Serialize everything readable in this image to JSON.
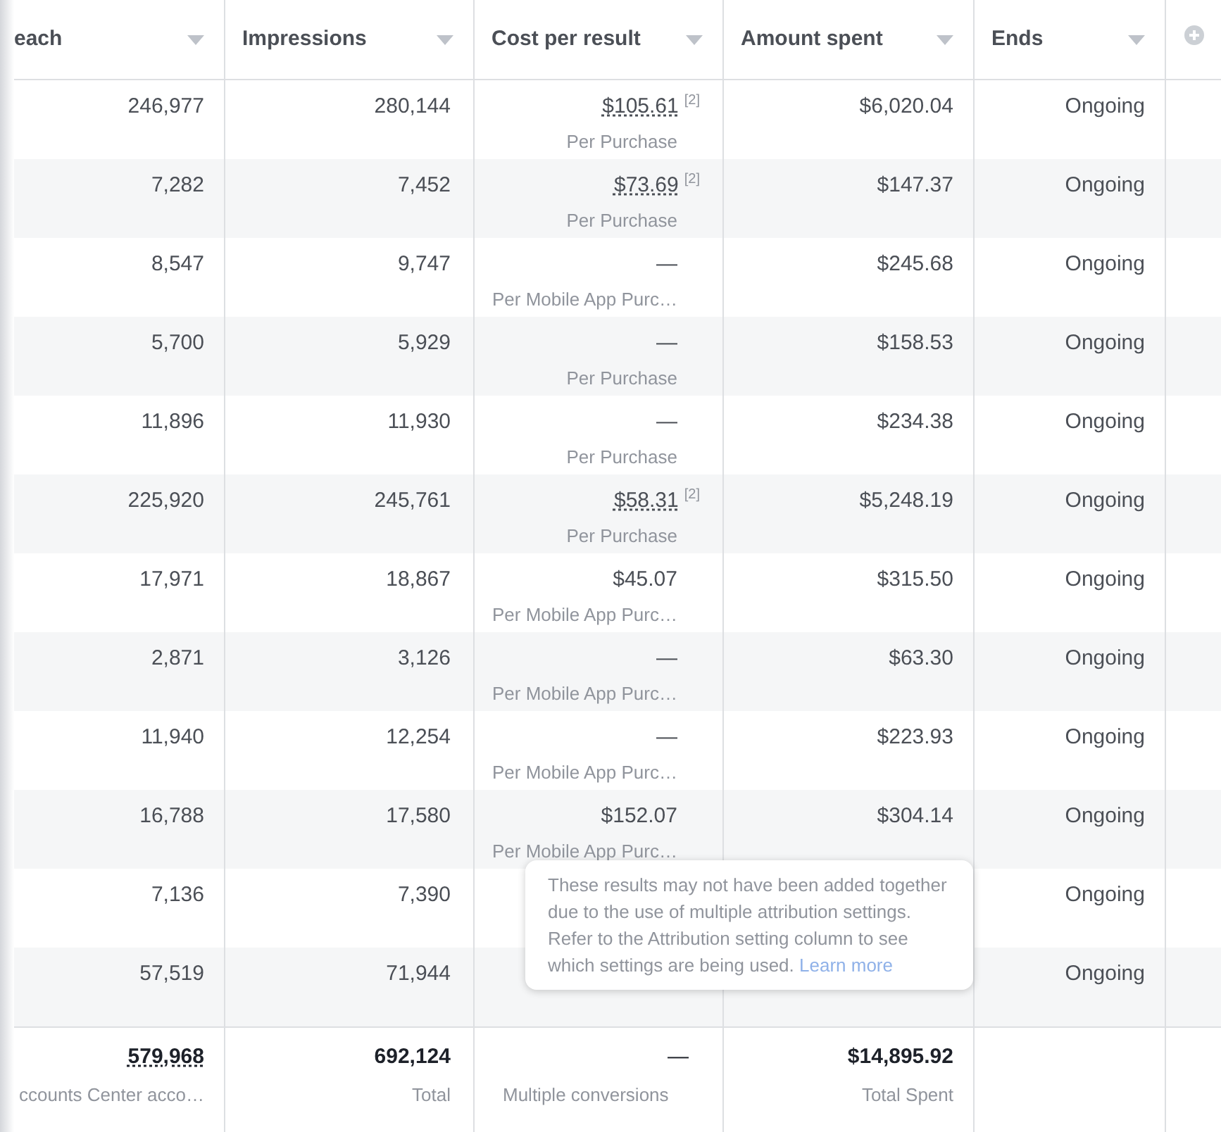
{
  "columns": [
    {
      "label": "each"
    },
    {
      "label": "Impressions"
    },
    {
      "label": "Cost per result"
    },
    {
      "label": "Amount spent"
    },
    {
      "label": "Ends"
    }
  ],
  "rows": [
    {
      "reach": "246,977",
      "impressions": "280,144",
      "cost": {
        "value": "$105.61",
        "note": "[2]",
        "sub": "Per Purchase"
      },
      "amount": "$6,020.04",
      "ends": "Ongoing"
    },
    {
      "reach": "7,282",
      "impressions": "7,452",
      "cost": {
        "value": "$73.69",
        "note": "[2]",
        "sub": "Per Purchase"
      },
      "amount": "$147.37",
      "ends": "Ongoing"
    },
    {
      "reach": "8,547",
      "impressions": "9,747",
      "cost": {
        "value": "—",
        "sub": "Per Mobile App Purc…"
      },
      "amount": "$245.68",
      "ends": "Ongoing"
    },
    {
      "reach": "5,700",
      "impressions": "5,929",
      "cost": {
        "value": "—",
        "sub": "Per Purchase"
      },
      "amount": "$158.53",
      "ends": "Ongoing"
    },
    {
      "reach": "11,896",
      "impressions": "11,930",
      "cost": {
        "value": "—",
        "sub": "Per Purchase"
      },
      "amount": "$234.38",
      "ends": "Ongoing"
    },
    {
      "reach": "225,920",
      "impressions": "245,761",
      "cost": {
        "value": "$58.31",
        "note": "[2]",
        "sub": "Per Purchase"
      },
      "amount": "$5,248.19",
      "ends": "Ongoing"
    },
    {
      "reach": "17,971",
      "impressions": "18,867",
      "cost": {
        "value": "$45.07",
        "sub": "Per Mobile App Purc…"
      },
      "amount": "$315.50",
      "ends": "Ongoing"
    },
    {
      "reach": "2,871",
      "impressions": "3,126",
      "cost": {
        "value": "—",
        "sub": "Per Mobile App Purc…"
      },
      "amount": "$63.30",
      "ends": "Ongoing"
    },
    {
      "reach": "11,940",
      "impressions": "12,254",
      "cost": {
        "value": "—",
        "sub": "Per Mobile App Purc…"
      },
      "amount": "$223.93",
      "ends": "Ongoing"
    },
    {
      "reach": "16,788",
      "impressions": "17,580",
      "cost": {
        "value": "$152.07",
        "sub": "Per Mobile App Purc…"
      },
      "amount": "$304.14",
      "ends": "Ongoing"
    },
    {
      "reach": "7,136",
      "impressions": "7,390",
      "ends": "Ongoing"
    },
    {
      "reach": "57,519",
      "impressions": "71,944",
      "ends": "Ongoing"
    }
  ],
  "totals": {
    "reach": {
      "value": "579,968",
      "sub": "ccounts Center acco…"
    },
    "impressions": {
      "value": "692,124",
      "sub": "Total"
    },
    "cost": {
      "value": "—",
      "sub": "Multiple conversions"
    },
    "amount": {
      "value": "$14,895.92",
      "sub": "Total Spent"
    }
  },
  "tooltip": {
    "text": "These results may not have been added together due to the use of multiple attribution settings. Refer to the Attribution setting column to see which settings are being used.",
    "link": "Learn more"
  }
}
